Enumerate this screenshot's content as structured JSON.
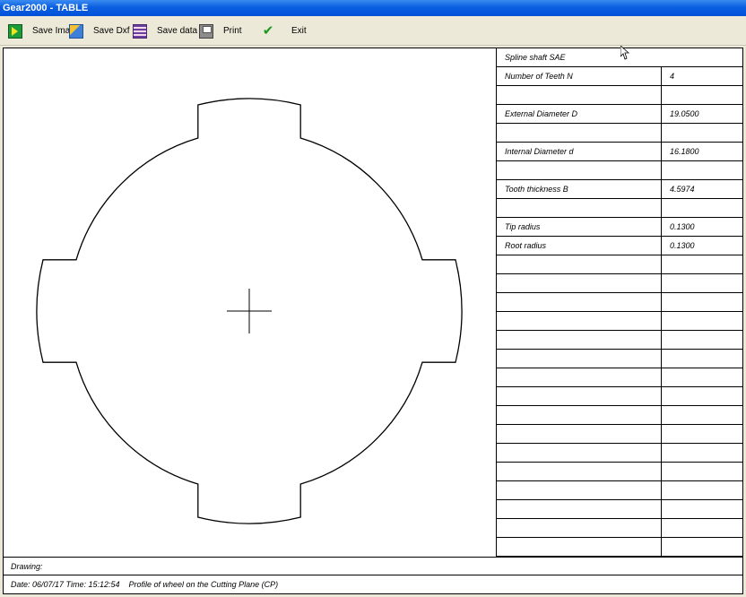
{
  "window": {
    "title": "Gear2000 - TABLE"
  },
  "toolbar": {
    "save_image": "Save Image",
    "save_dxf": "Save Dxf",
    "save_data": "Save data",
    "print": "Print",
    "exit": "Exit"
  },
  "table": {
    "header": "Spline shaft SAE",
    "rows": [
      {
        "label": "Number of Teeth N",
        "value": "4"
      },
      {
        "label": "",
        "value": ""
      },
      {
        "label": "External Diameter D",
        "value": "19.0500"
      },
      {
        "label": "",
        "value": ""
      },
      {
        "label": "Internal Diameter d",
        "value": "16.1800"
      },
      {
        "label": "",
        "value": ""
      },
      {
        "label": "Tooth thickness B",
        "value": "4.5974"
      },
      {
        "label": "",
        "value": ""
      },
      {
        "label": "Tip radius",
        "value": "0.1300"
      },
      {
        "label": "Root radius",
        "value": "0.1300"
      },
      {
        "label": "",
        "value": ""
      },
      {
        "label": "",
        "value": ""
      },
      {
        "label": "",
        "value": ""
      },
      {
        "label": "",
        "value": ""
      },
      {
        "label": "",
        "value": ""
      },
      {
        "label": "",
        "value": ""
      },
      {
        "label": "",
        "value": ""
      },
      {
        "label": "",
        "value": ""
      },
      {
        "label": "",
        "value": ""
      },
      {
        "label": "",
        "value": ""
      },
      {
        "label": "",
        "value": ""
      },
      {
        "label": "",
        "value": ""
      },
      {
        "label": "",
        "value": ""
      },
      {
        "label": "",
        "value": ""
      },
      {
        "label": "",
        "value": ""
      },
      {
        "label": "",
        "value": ""
      }
    ]
  },
  "footer": {
    "drawing": "Drawing:",
    "date_line": "Date: 06/07/17 Time: 15:12:54    Profile of wheel on the Cutting Plane (CP)"
  },
  "profile": {
    "number_of_teeth": 4,
    "external_diameter": 19.05,
    "internal_diameter": 16.18,
    "tooth_thickness": 4.5974
  }
}
